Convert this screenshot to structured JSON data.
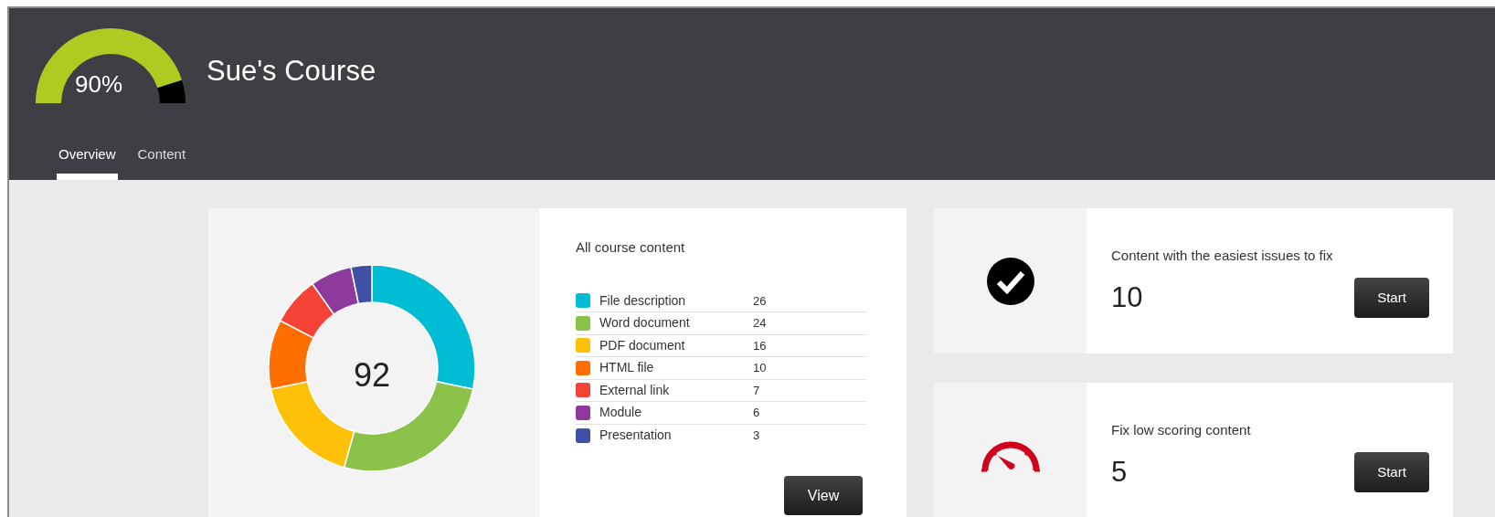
{
  "course": {
    "title": "Sue's Course",
    "score": "90%"
  },
  "tabs": [
    {
      "label": "Overview",
      "selected": true
    },
    {
      "label": "Content",
      "selected": false
    }
  ],
  "content_summary": {
    "total": "92",
    "title": "All course content",
    "legend": [
      {
        "label": "File description",
        "count": "26",
        "color": "#00bcd4"
      },
      {
        "label": "Word document",
        "count": "24",
        "color": "#8bc34a"
      },
      {
        "label": "PDF document",
        "count": "16",
        "color": "#ffc107"
      },
      {
        "label": "HTML file",
        "count": "10",
        "color": "#ff6f00"
      },
      {
        "label": "External link",
        "count": "7",
        "color": "#f44336"
      },
      {
        "label": "Module",
        "count": "6",
        "color": "#8e3a9d"
      },
      {
        "label": "Presentation",
        "count": "3",
        "color": "#3f51a5"
      }
    ],
    "button": "View"
  },
  "actions": [
    {
      "kind": "check",
      "title": "Content with the easiest issues to fix",
      "count": "10",
      "button": "Start"
    },
    {
      "kind": "gauge",
      "title": "Fix low scoring content",
      "count": "5",
      "button": "Start"
    }
  ]
}
